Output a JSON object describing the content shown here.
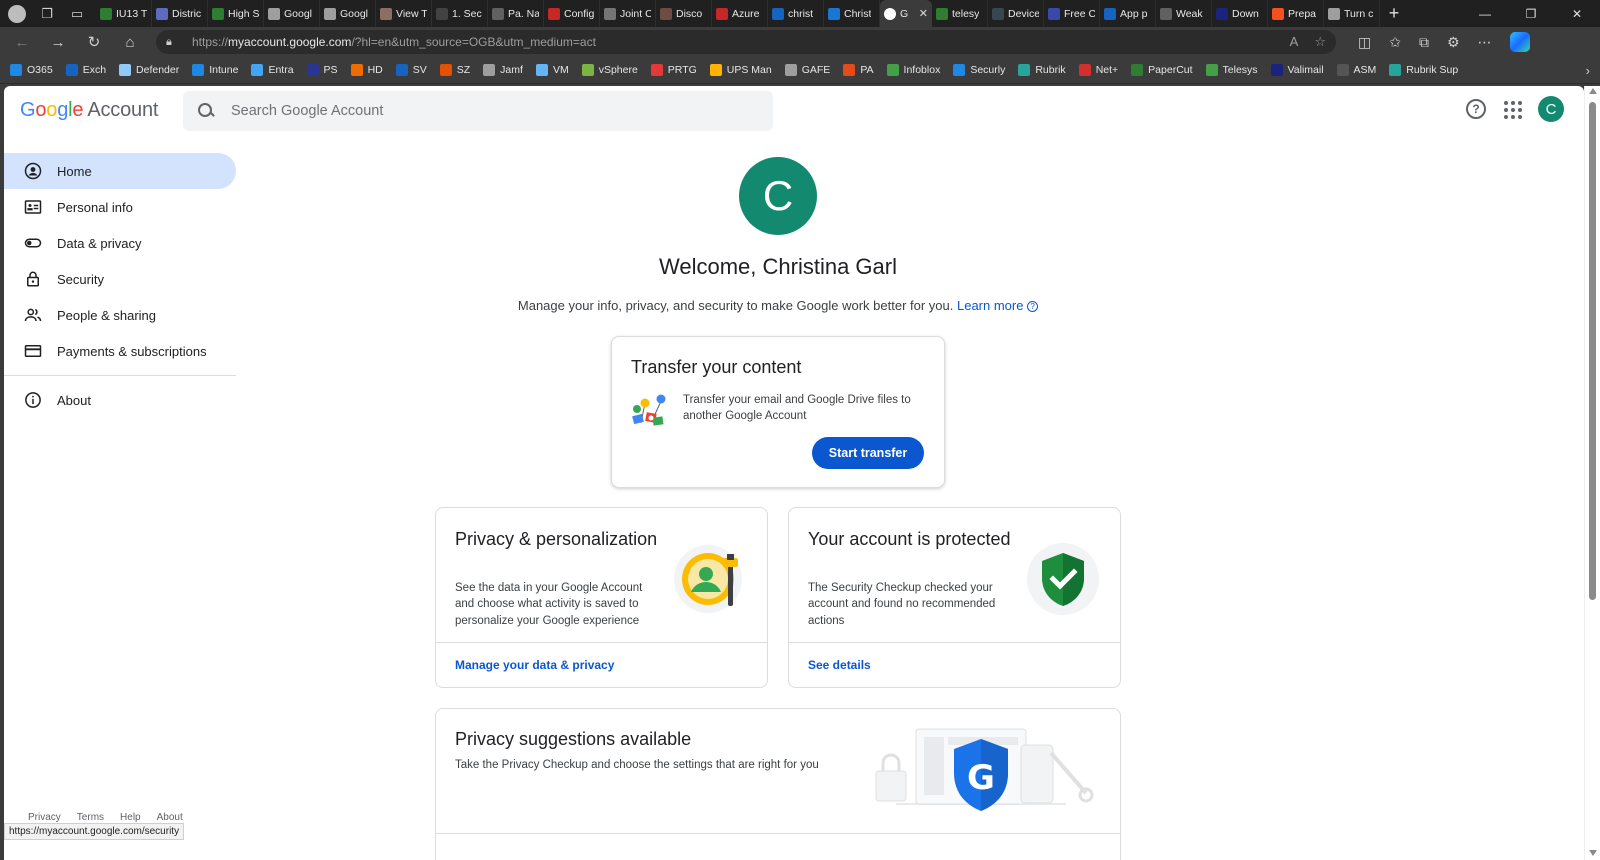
{
  "browser": {
    "tabs": [
      {
        "label": "IU13 T",
        "color": "#2e7d32"
      },
      {
        "label": "Distric",
        "color": "#5c6bc0"
      },
      {
        "label": "High S",
        "color": "#2e7d32"
      },
      {
        "label": "Googl",
        "color": "#9e9e9e"
      },
      {
        "label": "Googl",
        "color": "#9e9e9e"
      },
      {
        "label": "View T",
        "color": "#8d6e63"
      },
      {
        "label": "1. Sec",
        "color": "#424242"
      },
      {
        "label": "Pa. Na",
        "color": "#616161"
      },
      {
        "label": "Config",
        "color": "#c62828"
      },
      {
        "label": "Joint C",
        "color": "#757575"
      },
      {
        "label": "Disco",
        "color": "#6d4c41"
      },
      {
        "label": "Azure",
        "color": "#c62828"
      },
      {
        "label": "christ",
        "color": "#1565c0"
      },
      {
        "label": "Christ",
        "color": "#1976d2"
      }
    ],
    "active_tab": {
      "label": "G",
      "close": "✕"
    },
    "tabs_after": [
      {
        "label": "telesy",
        "color": "#2e7d32"
      },
      {
        "label": "Device",
        "color": "#37474f"
      },
      {
        "label": "Free C",
        "color": "#3949ab"
      },
      {
        "label": "App p",
        "color": "#1565c0"
      },
      {
        "label": "Weak",
        "color": "#616161"
      },
      {
        "label": "Down",
        "color": "#1a237e"
      },
      {
        "label": "Prepa",
        "color": "#f4511e"
      },
      {
        "label": "Turn c",
        "color": "#9e9e9e"
      }
    ],
    "url": {
      "scheme": "https://",
      "host": "myaccount.google.com",
      "path": "/?hl=en&utm_source=OGB&utm_medium=act"
    },
    "favorites": [
      {
        "label": "O365",
        "color": "#1e88e5"
      },
      {
        "label": "Exch",
        "color": "#1565c0"
      },
      {
        "label": "Defender",
        "color": "#90caf9"
      },
      {
        "label": "Intune",
        "color": "#1e88e5"
      },
      {
        "label": "Entra",
        "color": "#42a5f5"
      },
      {
        "label": "PS",
        "color": "#283593"
      },
      {
        "label": "HD",
        "color": "#ef6c00"
      },
      {
        "label": "SV",
        "color": "#1565c0"
      },
      {
        "label": "SZ",
        "color": "#e65100"
      },
      {
        "label": "Jamf",
        "color": "#9e9e9e"
      },
      {
        "label": "VM",
        "color": "#64b5f6"
      },
      {
        "label": "vSphere",
        "color": "#7cb342"
      },
      {
        "label": "PRTG",
        "color": "#e53935"
      },
      {
        "label": "UPS Man",
        "color": "#ffb300"
      },
      {
        "label": "GAFE",
        "color": "#9e9e9e"
      },
      {
        "label": "PA",
        "color": "#e64a19"
      },
      {
        "label": "Infoblox",
        "color": "#43a047"
      },
      {
        "label": "Securly",
        "color": "#1e88e5"
      },
      {
        "label": "Rubrik",
        "color": "#26a69a"
      },
      {
        "label": "Net+",
        "color": "#d32f2f"
      },
      {
        "label": "PaperCut",
        "color": "#2e7d32"
      },
      {
        "label": "Telesys",
        "color": "#43a047"
      },
      {
        "label": "Valimail",
        "color": "#1a237e"
      },
      {
        "label": "ASM",
        "color": "#555555"
      },
      {
        "label": "Rubrik Sup",
        "color": "#26a69a"
      }
    ]
  },
  "header": {
    "logo_letters": [
      "G",
      "o",
      "o",
      "g",
      "l",
      "e"
    ],
    "logo_suffix": "Account",
    "search_placeholder": "Search Google Account",
    "avatar_initial": "C"
  },
  "sidebar": {
    "items": [
      {
        "label": "Home",
        "icon": "account-circle-icon"
      },
      {
        "label": "Personal info",
        "icon": "id-card-icon"
      },
      {
        "label": "Data & privacy",
        "icon": "toggle-icon"
      },
      {
        "label": "Security",
        "icon": "lock-icon"
      },
      {
        "label": "People & sharing",
        "icon": "people-icon"
      },
      {
        "label": "Payments & subscriptions",
        "icon": "credit-card-icon"
      }
    ],
    "about": {
      "label": "About",
      "icon": "info-icon"
    },
    "footer": [
      "Privacy",
      "Terms",
      "Help",
      "About"
    ]
  },
  "main": {
    "avatar_initial": "C",
    "welcome": "Welcome, Christina Garl",
    "subtitle": "Manage your info, privacy, and security to make Google work better for you.",
    "learn_more": "Learn more",
    "transfer": {
      "title": "Transfer your content",
      "desc": "Transfer your email and Google Drive files to another Google Account",
      "button": "Start transfer"
    },
    "privacy_card": {
      "title": "Privacy & personalization",
      "desc": "See the data in your Google Account and choose what activity is saved to personalize your Google experience",
      "link": "Manage your data & privacy"
    },
    "security_card": {
      "title": "Your account is protected",
      "desc": "The Security Checkup checked your account and found no recommended actions",
      "link": "See details"
    },
    "suggest_card": {
      "title": "Privacy suggestions available",
      "desc": "Take the Privacy Checkup and choose the settings that are right for you"
    }
  },
  "status_bar": {
    "url": "https://myaccount.google.com/security"
  },
  "colors": {
    "accent": "#0b57d0",
    "avatar": "#138a70",
    "nav_active": "#d3e3fd"
  }
}
